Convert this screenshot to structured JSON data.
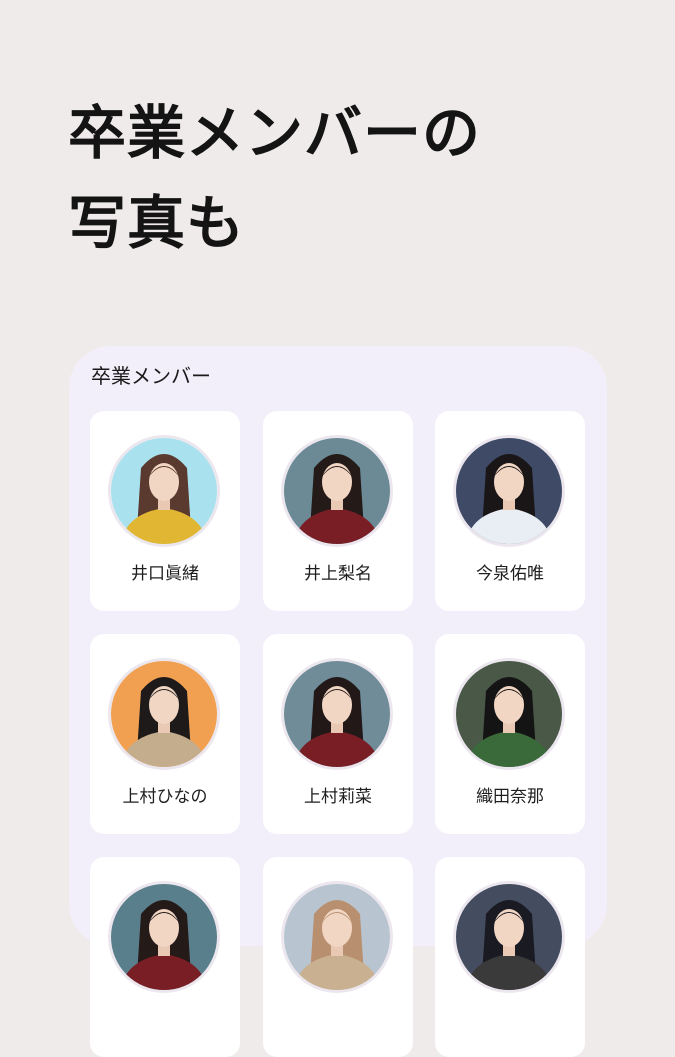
{
  "headline": {
    "line1": "卒業メンバーの",
    "line2": "写真も"
  },
  "section": {
    "title": "卒業メンバー"
  },
  "members": [
    {
      "name": "井口眞緒",
      "bg": "#a9e2ee",
      "outfit": "#e0b632",
      "hair": "#5a3a2e"
    },
    {
      "name": "井上梨名",
      "bg": "#6b8a96",
      "outfit": "#7a1e26",
      "hair": "#241a18"
    },
    {
      "name": "今泉佑唯",
      "bg": "#3e4a66",
      "outfit": "#e8eef4",
      "hair": "#1a1618"
    },
    {
      "name": "上村ひなの",
      "bg": "#f0a050",
      "outfit": "#c4ad8c",
      "hair": "#1e1a1a"
    },
    {
      "name": "上村莉菜",
      "bg": "#6f8c98",
      "outfit": "#7a1e26",
      "hair": "#221818"
    },
    {
      "name": "織田奈那",
      "bg": "#4a5848",
      "outfit": "#3a6a3a",
      "hair": "#141414"
    },
    {
      "name": "",
      "bg": "#5a7f8c",
      "outfit": "#7a1e26",
      "hair": "#241a18"
    },
    {
      "name": "",
      "bg": "#b8c4d0",
      "outfit": "#c8b090",
      "hair": "#b89070"
    },
    {
      "name": "",
      "bg": "#444c60",
      "outfit": "#3a3a3a",
      "hair": "#1a1a22"
    }
  ]
}
